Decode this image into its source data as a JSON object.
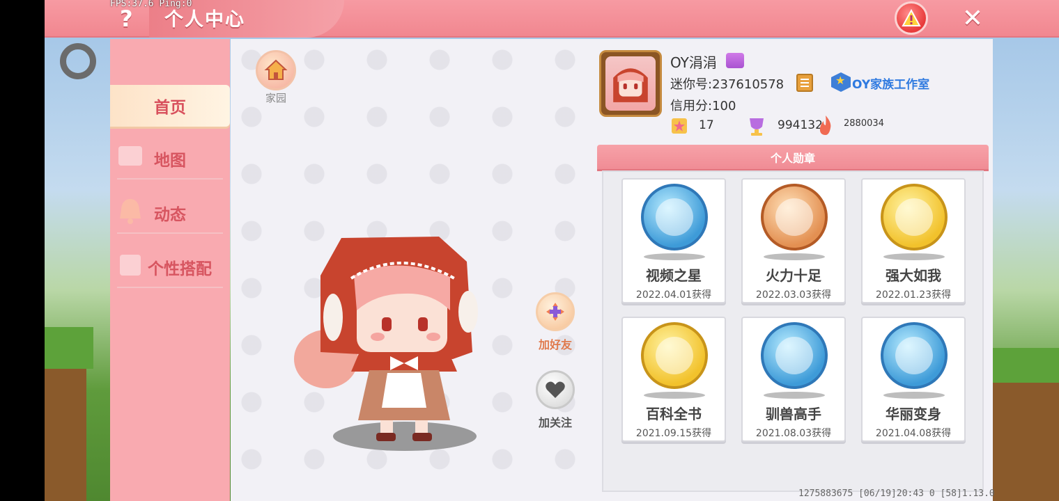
{
  "overlay": {
    "fps": "FPS:37.6  Ping:0"
  },
  "header": {
    "title": "个人中心",
    "help": "?",
    "close": "✕"
  },
  "sidebar": {
    "items": [
      {
        "label": "首页",
        "active": true
      },
      {
        "label": "地图",
        "active": false
      },
      {
        "label": "动态",
        "active": false
      },
      {
        "label": "个性搭配",
        "active": false
      }
    ]
  },
  "center": {
    "home_label": "家园",
    "add_friend_label": "加好友",
    "follow_label": "加关注"
  },
  "profile": {
    "nickname": "OY涓涓",
    "mini_id": "迷你号:237610578",
    "family": "OY家族工作室",
    "credit": "信用分:100",
    "stats": {
      "stat1": "17",
      "stat2": "994132",
      "stat3": "2880034"
    }
  },
  "medals": {
    "title": "个人勋章",
    "items": [
      {
        "name": "视频之星",
        "date": "2022.04.01获得",
        "tier": "blue"
      },
      {
        "name": "火力十足",
        "date": "2022.03.03获得",
        "tier": "bronze"
      },
      {
        "name": "强大如我",
        "date": "2022.01.23获得",
        "tier": "gold"
      },
      {
        "name": "百科全书",
        "date": "2021.09.15获得",
        "tier": "gold"
      },
      {
        "name": "驯兽高手",
        "date": "2021.08.03获得",
        "tier": "blue"
      },
      {
        "name": "华丽变身",
        "date": "2021.04.08获得",
        "tier": "blue"
      }
    ]
  },
  "footer": {
    "info": "1275883675  [06/19]20:43 0  [58]1.13.0"
  },
  "colors": {
    "header": "#f18790",
    "sidebar": "#f9aab0",
    "accent_text": "#d8505c",
    "family_link": "#2f7ae0"
  },
  "icons": [
    "help-icon",
    "alert-icon",
    "close-icon",
    "ring-icon",
    "home-icon",
    "add-friend-icon",
    "heart-icon",
    "copy-icon",
    "family-icon",
    "star-icon",
    "trophy-icon",
    "fire-icon"
  ]
}
